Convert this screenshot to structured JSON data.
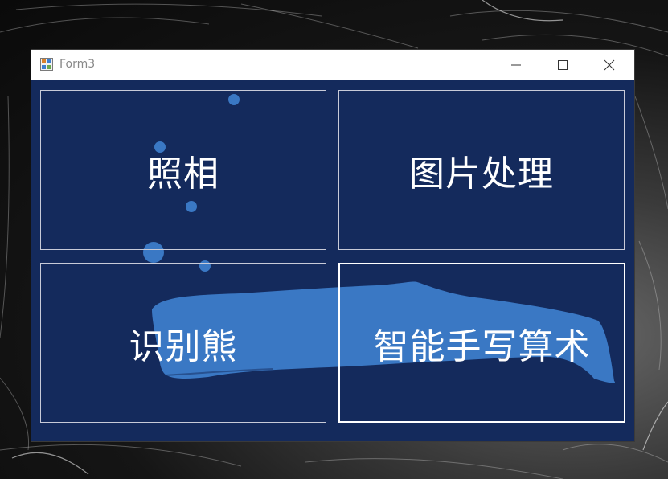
{
  "window": {
    "title": "Form3",
    "background_color": "#142a5c",
    "titlebar_color": "#ffffff"
  },
  "controls": {
    "minimize_icon": "minimize-icon",
    "maximize_icon": "maximize-icon",
    "close_icon": "close-icon"
  },
  "tiles": [
    {
      "label": "照相",
      "selected": false
    },
    {
      "label": "图片处理",
      "selected": false
    },
    {
      "label": "识别熊",
      "selected": false
    },
    {
      "label": "智能手写算术",
      "selected": true
    }
  ],
  "decoration": {
    "whale_color": "#3a78c4",
    "bubble_color": "#3a78c4"
  }
}
